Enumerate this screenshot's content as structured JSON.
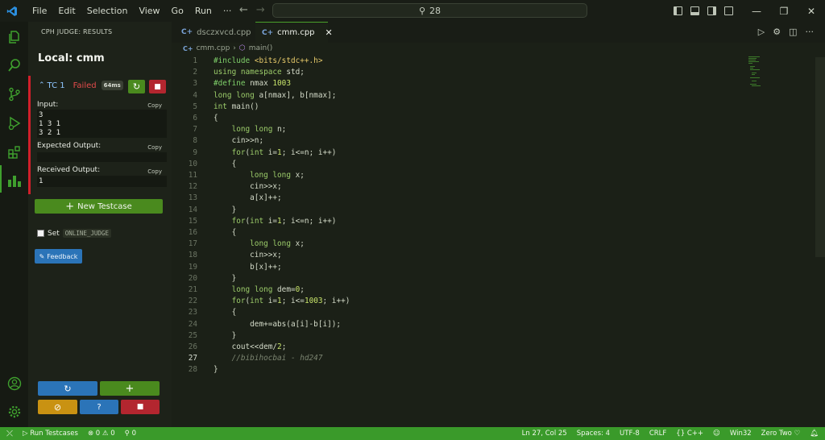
{
  "menu": [
    "File",
    "Edit",
    "Selection",
    "View",
    "Go",
    "Run",
    "···"
  ],
  "search": {
    "text": "28"
  },
  "sidebar": {
    "title": "CPH JUDGE: RESULTS",
    "heading": "Local: cmm",
    "testcase": {
      "name": "TC 1",
      "status": "Failed",
      "time": "64ms"
    },
    "input_label": "Input:",
    "input_value": "3\n1 3 1\n3 2 1",
    "expected_label": "Expected Output:",
    "expected_value": "",
    "received_label": "Received Output:",
    "received_value": "1",
    "copy_label": "Copy",
    "new_testcase": "New Testcase",
    "set_label": "Set",
    "online_judge": "ONLINE_JUDGE",
    "feedback": "Feedback"
  },
  "tabs": [
    {
      "label": "dsczxvcd.cpp",
      "active": false
    },
    {
      "label": "cmm.cpp",
      "active": true
    }
  ],
  "breadcrumb": {
    "file": "cmm.cpp",
    "symbol": "main()"
  },
  "code": [
    "#include <bits/stdc++.h>",
    "using namespace std;",
    "#define nmax 1003",
    "long long a[nmax], b[nmax];",
    "int main()",
    "{",
    "    long long n;",
    "    cin>>n;",
    "    for(int i=1; i<=n; i++)",
    "    {",
    "        long long x;",
    "        cin>>x;",
    "        a[x]++;",
    "    }",
    "    for(int i=1; i<=n; i++)",
    "    {",
    "        long long x;",
    "        cin>>x;",
    "        b[x]++;",
    "    }",
    "    long long dem=0;",
    "    for(int i=1; i<=1003; i++)",
    "    {",
    "        dem+=abs(a[i]-b[i]);",
    "    }",
    "    cout<<dem/2;",
    "    //bibihocbai - hd247",
    "}"
  ],
  "current_line": 27,
  "statusbar": {
    "run": "Run Testcases",
    "errors": "0",
    "warnings": "0",
    "ports": "0",
    "position": "Ln 27, Col 25",
    "spaces": "Spaces: 4",
    "encoding": "UTF-8",
    "eol": "CRLF",
    "language": "C++",
    "platform": "Win32",
    "theme": "Zero Two"
  },
  "colors": {
    "accent": "#3a9a2a",
    "failed": "#d11f2a",
    "keyword": "#9ccc6a",
    "preproc": "#7fd06a",
    "string": "#e6c96a",
    "number": "#c7e36a",
    "comment": "#7b8470"
  }
}
